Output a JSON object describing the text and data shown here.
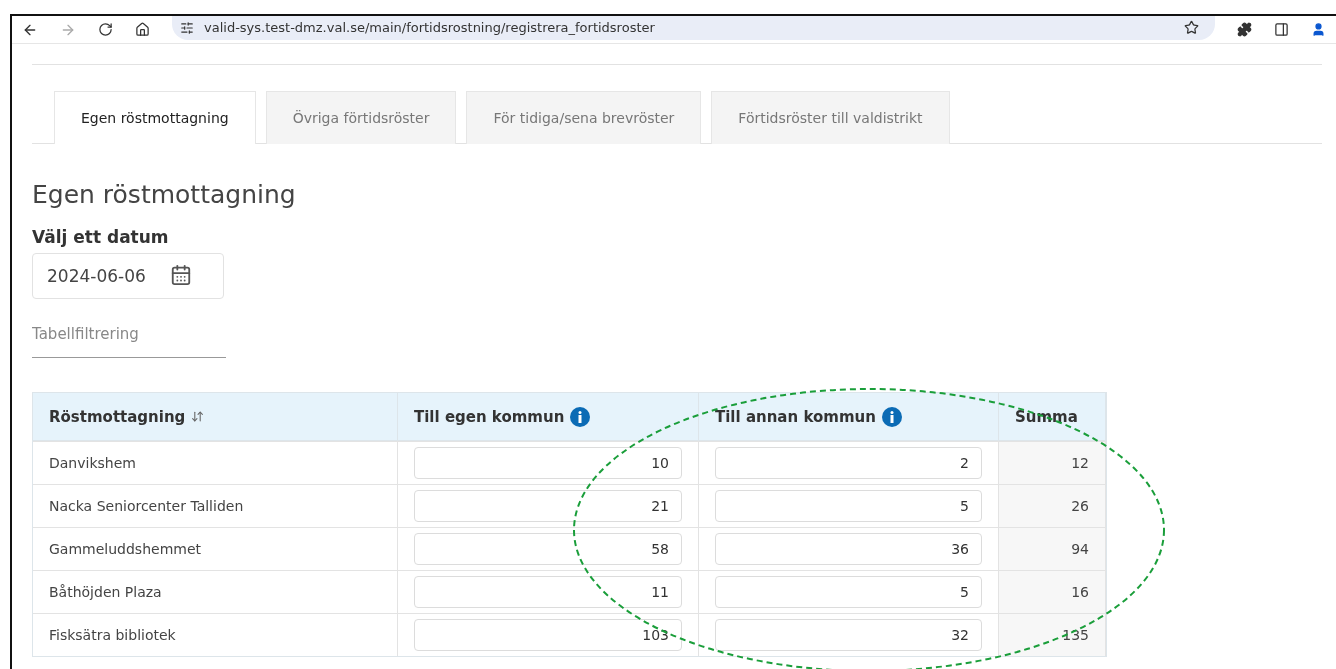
{
  "browser": {
    "url": "valid-sys.test-dmz.val.se/main/fortidsrostning/registrera_fortidsroster"
  },
  "tabs": [
    {
      "label": "Egen röstmottagning",
      "selected": true
    },
    {
      "label": "Övriga förtidsröster",
      "selected": false
    },
    {
      "label": "För tidiga/sena brevröster",
      "selected": false
    },
    {
      "label": "Förtidsröster till valdistrikt",
      "selected": false
    }
  ],
  "heading": "Egen röstmottagning",
  "date_label": "Välj ett datum",
  "date_value": "2024-06-06",
  "filter_placeholder": "Tabellfiltrering",
  "table": {
    "columns": [
      {
        "label": "Röstmottagning",
        "kind": "sort"
      },
      {
        "label": "Till egen kommun",
        "kind": "info"
      },
      {
        "label": "Till annan kommun",
        "kind": "info"
      },
      {
        "label": "Summa",
        "kind": "plain"
      }
    ],
    "rows": [
      {
        "name": "Danvikshem",
        "egen": "10",
        "annan": "2",
        "summa": "12"
      },
      {
        "name": "Nacka Seniorcenter Talliden",
        "egen": "21",
        "annan": "5",
        "summa": "26"
      },
      {
        "name": "Gammeluddshemmet",
        "egen": "58",
        "annan": "36",
        "summa": "94"
      },
      {
        "name": "Båthöjden Plaza",
        "egen": "11",
        "annan": "5",
        "summa": "16"
      },
      {
        "name": "Fisksätra bibliotek",
        "egen": "103",
        "annan": "32",
        "summa": "135"
      }
    ]
  }
}
